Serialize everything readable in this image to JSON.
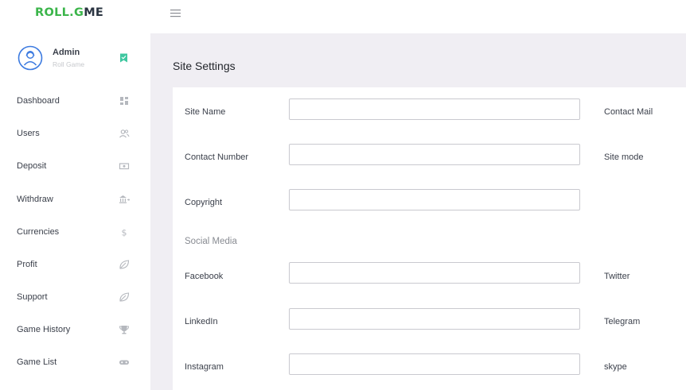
{
  "brand": {
    "logo_part1": "ROLL.G",
    "logo_part2": "ME",
    "logo_accent_glyph": "&"
  },
  "profile": {
    "name": "Admin",
    "subtitle": "Roll Game"
  },
  "sidebar": {
    "items": [
      {
        "label": "Dashboard",
        "icon": "dashboard-icon"
      },
      {
        "label": "Users",
        "icon": "users-icon"
      },
      {
        "label": "Deposit",
        "icon": "money-icon"
      },
      {
        "label": "Withdraw",
        "icon": "bank-icon"
      },
      {
        "label": "Currencies",
        "icon": "dollar-icon"
      },
      {
        "label": "Profit",
        "icon": "leaf-icon"
      },
      {
        "label": "Support",
        "icon": "leaf-icon"
      },
      {
        "label": "Game History",
        "icon": "trophy-icon"
      },
      {
        "label": "Game List",
        "icon": "gamepad-icon"
      }
    ]
  },
  "page": {
    "title": "Site Settings"
  },
  "form": {
    "site_name": {
      "label": "Site Name",
      "value": ""
    },
    "contact_mail": {
      "label": "Contact Mail"
    },
    "contact_number": {
      "label": "Contact Number",
      "value": ""
    },
    "site_mode": {
      "label": "Site mode"
    },
    "copyright": {
      "label": "Copyright",
      "value": ""
    },
    "social_title": "Social Media",
    "facebook": {
      "label": "Facebook",
      "value": ""
    },
    "twitter": {
      "label": "Twitter"
    },
    "linkedin": {
      "label": "LinkedIn",
      "value": ""
    },
    "telegram": {
      "label": "Telegram"
    },
    "instagram": {
      "label": "Instagram",
      "value": ""
    },
    "skype": {
      "label": "skype"
    }
  },
  "colors": {
    "brand_green": "#3bb54a",
    "brand_dark": "#2a3441",
    "accent_blue": "#3d7be0",
    "badge_teal": "#3fc7a0",
    "content_bg": "#f0eef3"
  }
}
